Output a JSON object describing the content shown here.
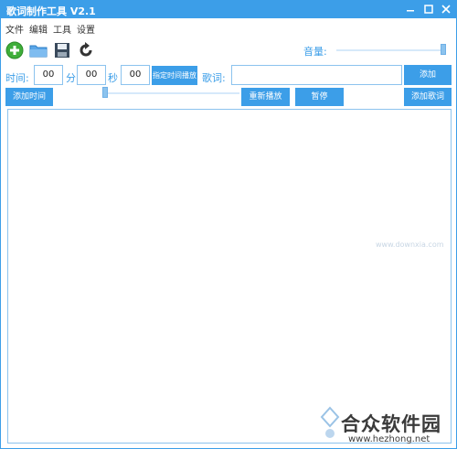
{
  "window": {
    "title": "歌词制作工具 V2.1",
    "min_icon": "minimize-icon",
    "max_icon": "maximize-icon",
    "close_icon": "close-icon"
  },
  "menu": [
    "文件",
    "编辑",
    "工具",
    "设置"
  ],
  "toolbar": {
    "icons": [
      "add-icon",
      "open-folder-icon",
      "save-icon",
      "refresh-icon"
    ]
  },
  "volume": {
    "label": "音量:",
    "level": 1.0
  },
  "time": {
    "label": "时间:",
    "minutes": "00",
    "min_label": "分",
    "seconds": "00",
    "sec_label": "秒",
    "frames": "00",
    "play_at_button": "指定时间播放"
  },
  "lyrics": {
    "label": "歌词:",
    "value": "",
    "add_button": "添加"
  },
  "actions": {
    "add_time": "添加时间",
    "restart": "重新播放",
    "pause": "暂停",
    "add_lyrics": "添加歌词"
  },
  "progress": {
    "level": 0.0
  },
  "editor": {
    "content": ""
  },
  "watermark": {
    "title": "合众软件园",
    "url": "www.hezhong.net",
    "faint": "www.downxia.com"
  },
  "colors": {
    "accent": "#3c9ee8",
    "border": "#8cc3ee"
  }
}
